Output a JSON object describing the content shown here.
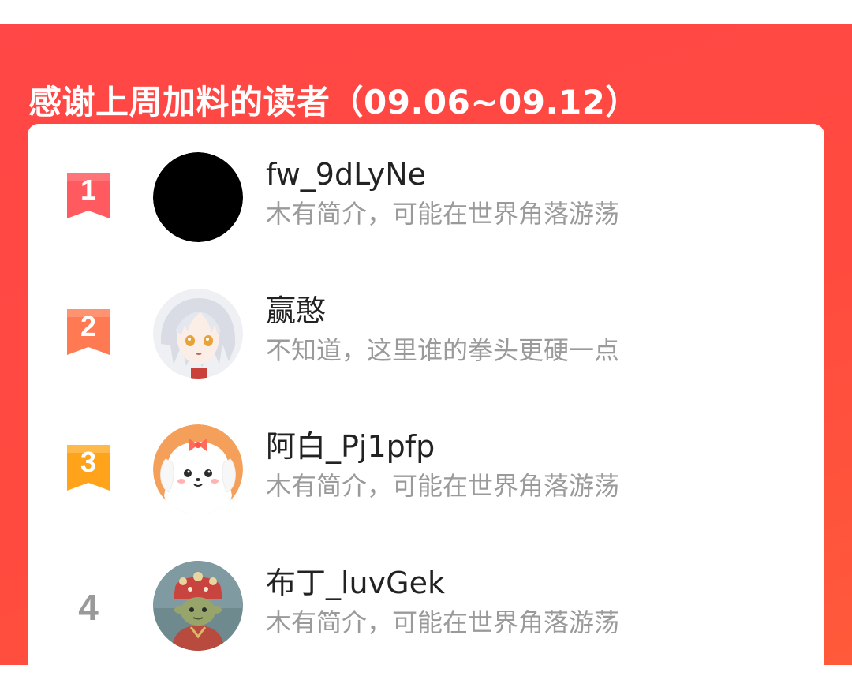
{
  "header": {
    "title": "感谢上周加料的读者（09.06~09.12）"
  },
  "colors": {
    "panel_bg": "#ff4747",
    "rank_1": "#ff5a5f",
    "rank_2": "#ff7a52",
    "rank_3": "#ffa31a",
    "rank_plain": "#9a9a9a"
  },
  "readers": [
    {
      "rank": "1",
      "username": "fw_9dLyNe",
      "bio": "木有简介，可能在世界角落游荡",
      "avatar_icon": "black-circle-avatar"
    },
    {
      "rank": "2",
      "username": "赢憨",
      "bio": "不知道，这里谁的拳头更硬一点",
      "avatar_icon": "anime-girl-avatar"
    },
    {
      "rank": "3",
      "username": "阿白_Pj1pfp",
      "bio": "木有简介，可能在世界角落游荡",
      "avatar_icon": "cartoon-dog-avatar"
    },
    {
      "rank": "4",
      "username": "布丁_luvGek",
      "bio": "木有简介，可能在世界角落游荡",
      "avatar_icon": "opera-costume-avatar"
    }
  ]
}
